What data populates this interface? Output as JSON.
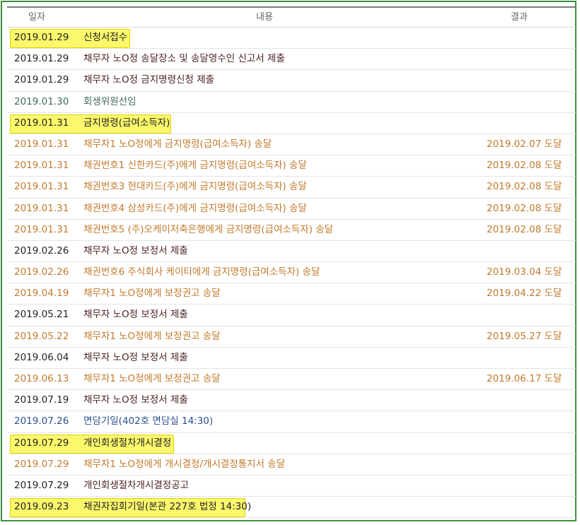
{
  "header": {
    "date": "일자",
    "content": "내용",
    "result": "결과"
  },
  "rows": [
    {
      "date": "2019.01.29",
      "content": "신청서접수",
      "result": "",
      "style": "dark",
      "highlight": true
    },
    {
      "date": "2019.01.29",
      "content": "채무자 노O정 송달장소 및 송달영수인 신고서 제출",
      "result": "",
      "style": "dark",
      "highlight": false
    },
    {
      "date": "2019.01.29",
      "content": "채무자 노O정 금지명령신청 제출",
      "result": "",
      "style": "dark",
      "highlight": false
    },
    {
      "date": "2019.01.30",
      "content": "회생위원선임",
      "result": "",
      "style": "teal",
      "highlight": false
    },
    {
      "date": "2019.01.31",
      "content": "금지명령(급여소득자)",
      "result": "",
      "style": "dark",
      "highlight": true
    },
    {
      "date": "2019.01.31",
      "content": "채무자1 노O정에게 금지명령(급여소득자) 송달",
      "result": "2019.02.07 도달",
      "style": "orange",
      "highlight": false
    },
    {
      "date": "2019.01.31",
      "content": "채권번호1 신한카드(주)에게 금지명령(급여소득자) 송달",
      "result": "2019.02.08 도달",
      "style": "orange",
      "highlight": false
    },
    {
      "date": "2019.01.31",
      "content": "채권번호3 현대카드(주)에게 금지명령(급여소득자) 송달",
      "result": "2019.02.08 도달",
      "style": "orange",
      "highlight": false
    },
    {
      "date": "2019.01.31",
      "content": "채권번호4 삼성카드(주)에게 금지명령(급여소득자) 송달",
      "result": "2019.02.08 도달",
      "style": "orange",
      "highlight": false
    },
    {
      "date": "2019.01.31",
      "content": "채권번호5 (주)오케이저축은행에게 금지명령(급여소득자) 송달",
      "result": "2019.02.08 도달",
      "style": "orange",
      "highlight": false
    },
    {
      "date": "2019.02.26",
      "content": "채무자 노O정 보정서 제출",
      "result": "",
      "style": "dark",
      "highlight": false
    },
    {
      "date": "2019.02.26",
      "content": "채권번호6 주식회사 케이티에게 금지명령(급여소득자) 송달",
      "result": "2019.03.04 도달",
      "style": "orange",
      "highlight": false
    },
    {
      "date": "2019.04.19",
      "content": "채무자1 노O정에게 보정권고 송달",
      "result": "2019.04.22 도달",
      "style": "orange",
      "highlight": false
    },
    {
      "date": "2019.05.21",
      "content": "채무자 노O정 보정서 제출",
      "result": "",
      "style": "dark",
      "highlight": false
    },
    {
      "date": "2019.05.22",
      "content": "채무자1 노O정에게 보정권고 송달",
      "result": "2019.05.27 도달",
      "style": "orange",
      "highlight": false
    },
    {
      "date": "2019.06.04",
      "content": "채무자 노O정 보정서 제출",
      "result": "",
      "style": "dark",
      "highlight": false
    },
    {
      "date": "2019.06.13",
      "content": "채무자1 노O정에게 보정권고 송달",
      "result": "2019.06.17 도달",
      "style": "orange",
      "highlight": false
    },
    {
      "date": "2019.07.19",
      "content": "채무자 노O정 보정서 제출",
      "result": "",
      "style": "dark",
      "highlight": false
    },
    {
      "date": "2019.07.26",
      "content": "면담기일(402호 면담실 14:30)",
      "result": "",
      "style": "blue",
      "highlight": false
    },
    {
      "date": "2019.07.29",
      "content": "개인회생절차개시결정",
      "result": "",
      "style": "dark",
      "highlight": true
    },
    {
      "date": "2019.07.29",
      "content": "채무자1 노O정에게 개시결정/개시결정통지서 송달",
      "result": "",
      "style": "orange",
      "highlight": false
    },
    {
      "date": "2019.07.29",
      "content": "개인회생절차개시결정공고",
      "result": "",
      "style": "dark",
      "highlight": false
    },
    {
      "date": "2019.09.23",
      "content": "채권자집회기일(본관 227호 법정 14:30)",
      "result": "",
      "style": "dark",
      "highlight": true
    }
  ],
  "colors": {
    "frame_border": "#3c8f3c",
    "highlight": "#fbf86c",
    "orange_text": "#c27a2c",
    "blue_text": "#2d4f8e",
    "teal_text": "#3f6b5a"
  }
}
